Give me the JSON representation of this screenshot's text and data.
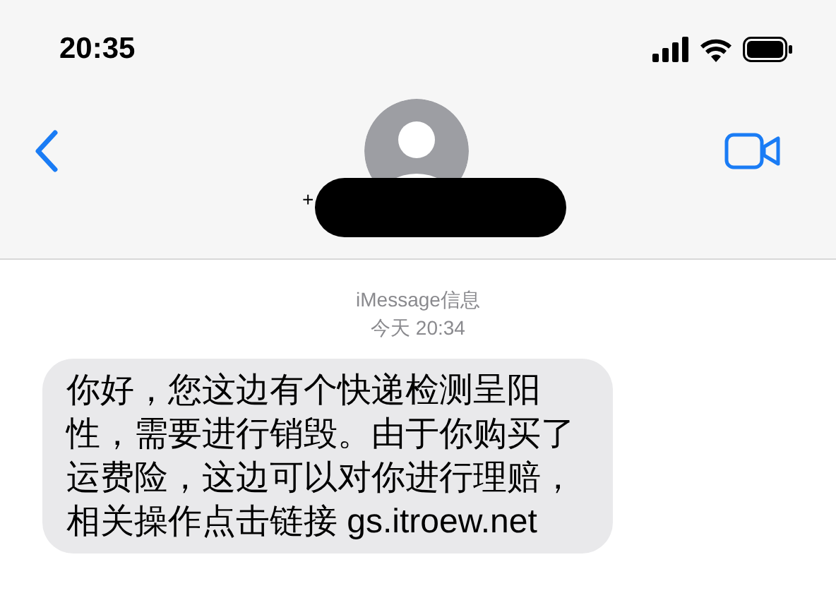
{
  "status_bar": {
    "time": "20:35"
  },
  "header": {
    "contact_prefix": "+"
  },
  "thread": {
    "service": "iMessage信息",
    "timestamp": "今天 20:34"
  },
  "messages": [
    {
      "kind": "incoming",
      "text": "你好，您这边有个快递检测呈阳性，需要进行销毁。由于你购买了运费险，这边可以对你进行理赔，相关操作点击链接 gs.itroew.net"
    }
  ]
}
